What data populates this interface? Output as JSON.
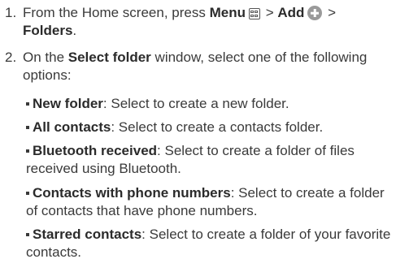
{
  "steps": [
    {
      "number": "1.",
      "text_pre": "From the Home screen, press ",
      "menu_label": "Menu",
      "sep1": " > ",
      "add_label": "Add",
      "sep2": " > ",
      "folders_label": "Folders",
      "end": "."
    },
    {
      "number": "2.",
      "text_pre": "On the ",
      "window_label": "Select folder",
      "text_post": " window, select one of the following options:"
    }
  ],
  "options": [
    {
      "label": "New folder",
      "desc": ": Select to create a new folder."
    },
    {
      "label": "All contacts",
      "desc": ": Select to create a contacts folder."
    },
    {
      "label": "Bluetooth received",
      "desc": ": Select to create a folder of files received using Bluetooth."
    },
    {
      "label": "Contacts with phone numbers",
      "desc": ": Select to create a folder of contacts that have phone numbers."
    },
    {
      "label": "Starred contacts",
      "desc": ": Select to create a folder of your favorite contacts."
    }
  ]
}
